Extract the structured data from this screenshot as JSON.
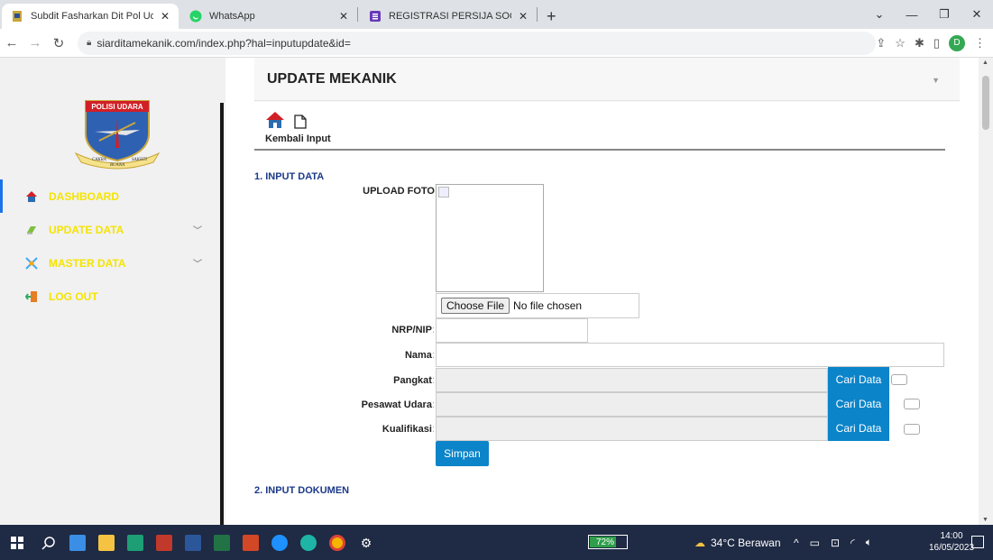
{
  "browser": {
    "tabs": [
      {
        "title": "Subdit Fasharkan Dit Pol Udara",
        "active": true
      },
      {
        "title": "WhatsApp",
        "active": false
      },
      {
        "title": "REGISTRASI PERSIJA SOCCER SC",
        "active": false
      }
    ],
    "new_tab": "+",
    "url": "siarditamekanik.com/index.php?hal=inputupdate&id=",
    "profile_initial": "D"
  },
  "sidebar": {
    "logo_text": "POLISI UDARA",
    "logo_ribbon_left": "CAKRA",
    "logo_ribbon_center": "BUANA",
    "logo_ribbon_right": "SAKHTI",
    "items": [
      {
        "label": "DASHBOARD",
        "icon": "home-icon",
        "active": true
      },
      {
        "label": "UPDATE DATA",
        "icon": "update-icon",
        "has_chevron": true
      },
      {
        "label": "MASTER DATA",
        "icon": "master-icon",
        "has_chevron": true
      },
      {
        "label": "LOG OUT",
        "icon": "logout-icon"
      }
    ]
  },
  "page": {
    "title": "UPDATE MEKANIK",
    "back_label": "Kembali Input",
    "section1": "1. INPUT DATA",
    "section2": "2. INPUT DOKUMEN",
    "upload_label": "UPLOAD FOTO",
    "file_button": "Choose File",
    "file_status": "No file chosen",
    "fields": {
      "nrp": "NRP/NIP",
      "nama": "Nama",
      "pangkat": "Pangkat",
      "pesawat": "Pesawat Udara",
      "kualifikasi": "Kualifikasi"
    },
    "cari_label": "Cari Data",
    "simpan_label": "Simpan"
  },
  "taskbar": {
    "battery": "72%",
    "battery_level": 0.72,
    "weather": "34°C Berawan",
    "time": "14:00",
    "date": "16/05/2023"
  },
  "colors": {
    "menu_text": "#f5e400",
    "accent_blue": "#0b84c9",
    "section_title": "#1c3a8a"
  }
}
